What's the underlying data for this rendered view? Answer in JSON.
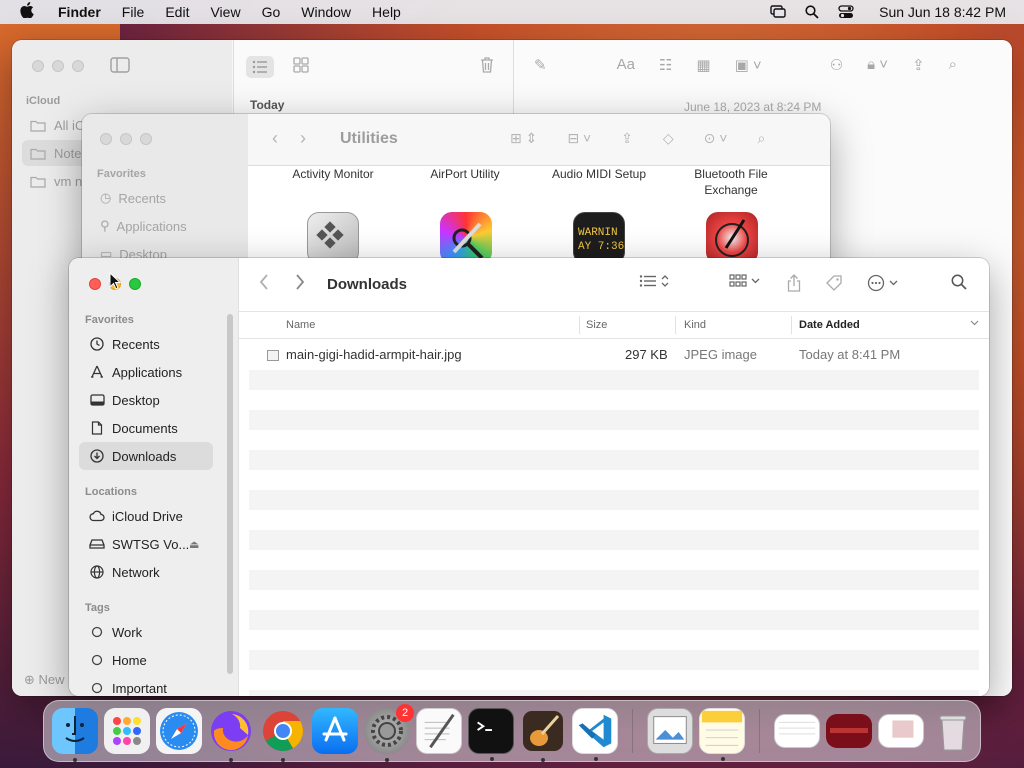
{
  "menubar": {
    "app_name": "Finder",
    "menus": [
      "File",
      "Edit",
      "View",
      "Go",
      "Window",
      "Help"
    ],
    "clock": "Sun Jun 18  8:42 PM"
  },
  "notes_window": {
    "section": "iCloud",
    "rows": [
      "All iC",
      "Note",
      "vm n"
    ],
    "new_folder": "New",
    "list_group": "Today",
    "note_date": "June 18, 2023 at 8:24 PM"
  },
  "utilities_window": {
    "title": "Utilities",
    "favorites_label": "Favorites",
    "sidebar_items": [
      "Recents",
      "Applications",
      "Desktop"
    ],
    "apps": [
      "Activity Monitor",
      "AirPort Utility",
      "Audio MIDI Setup",
      "Bluetooth File Exchange"
    ],
    "warning_text_1": "WARNIN",
    "warning_text_2": "AY 7:36"
  },
  "downloads_window": {
    "title": "Downloads",
    "sidebar": {
      "favorites_label": "Favorites",
      "favorites": [
        "Recents",
        "Applications",
        "Desktop",
        "Documents",
        "Downloads"
      ],
      "locations_label": "Locations",
      "locations": [
        "iCloud Drive",
        "SWTSG Vo...",
        "Network"
      ],
      "tags_label": "Tags",
      "tags": [
        "Work",
        "Home",
        "Important"
      ]
    },
    "columns": {
      "name": "Name",
      "size": "Size",
      "kind": "Kind",
      "date_added": "Date Added"
    },
    "files": [
      {
        "name": "main-gigi-hadid-armpit-hair.jpg",
        "size": "297 KB",
        "kind": "JPEG image",
        "date_added": "Today at 8:41 PM"
      }
    ]
  },
  "dock": {
    "settings_badge": "2"
  }
}
